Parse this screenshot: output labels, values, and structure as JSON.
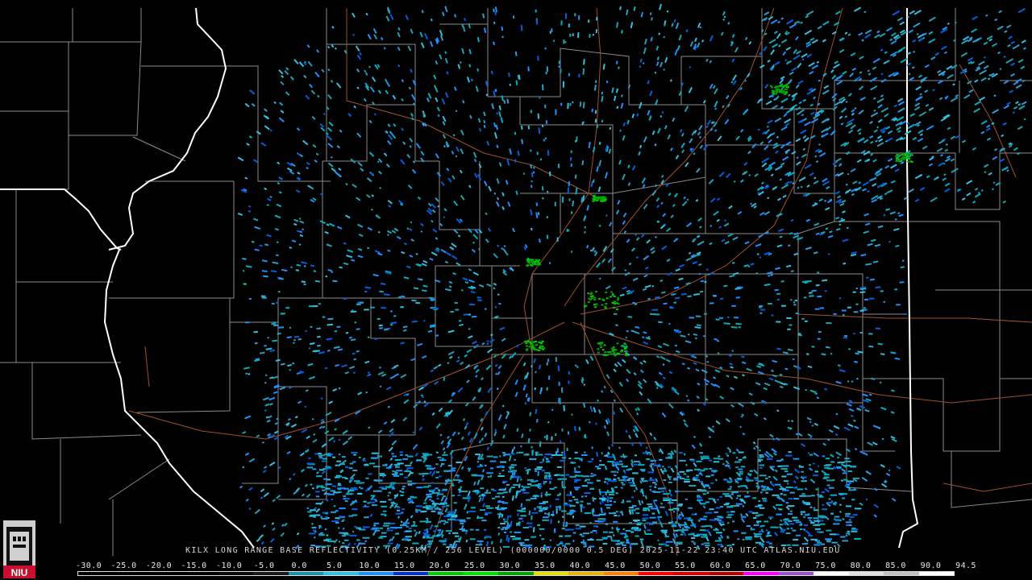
{
  "caption": "KILX LONG RANGE BASE REFLECTIVITY (0.25KM / 256 LEVEL) (000000/0000 0.5 DEG) 2025-11-22 23:40 UTC  ATLAS.NIU.EDU",
  "logo": {
    "text": "NIU",
    "color": "#c8102e"
  },
  "scale": {
    "labels": [
      "-30.0",
      "-25.0",
      "-20.0",
      "-15.0",
      "-10.0",
      "-5.0",
      "0.0",
      "5.0",
      "10.0",
      "15.0",
      "20.0",
      "25.0",
      "30.0",
      "35.0",
      "40.0",
      "45.0",
      "50.0",
      "55.0",
      "60.0",
      "65.0",
      "70.0",
      "75.0",
      "80.0",
      "85.0",
      "90.0",
      "94.5"
    ],
    "colors": [
      "#000000",
      "#000000",
      "#000000",
      "#000000",
      "#0a0a0a",
      "#1a1a1a",
      "#1f8fa8",
      "#33c0e0",
      "#1e90ff",
      "#0030c8",
      "#00c800",
      "#00e000",
      "#00a000",
      "#e0e000",
      "#e8b000",
      "#ff8000",
      "#ff0000",
      "#d00000",
      "#b00000",
      "#ff00ff",
      "#9955cc",
      "#ffffff",
      "#e0e0e0",
      "#c0c0c0",
      "#ffffff"
    ]
  },
  "map": {
    "boundary_color": "#ffffff",
    "county_color": "#8c8c8c",
    "road_color": "#a0522d",
    "echo_colors": [
      "#1e90ff",
      "#33c0e0",
      "#2aa0d0",
      "#00b0c0",
      "#0060e0",
      "#1fa0b0"
    ]
  }
}
